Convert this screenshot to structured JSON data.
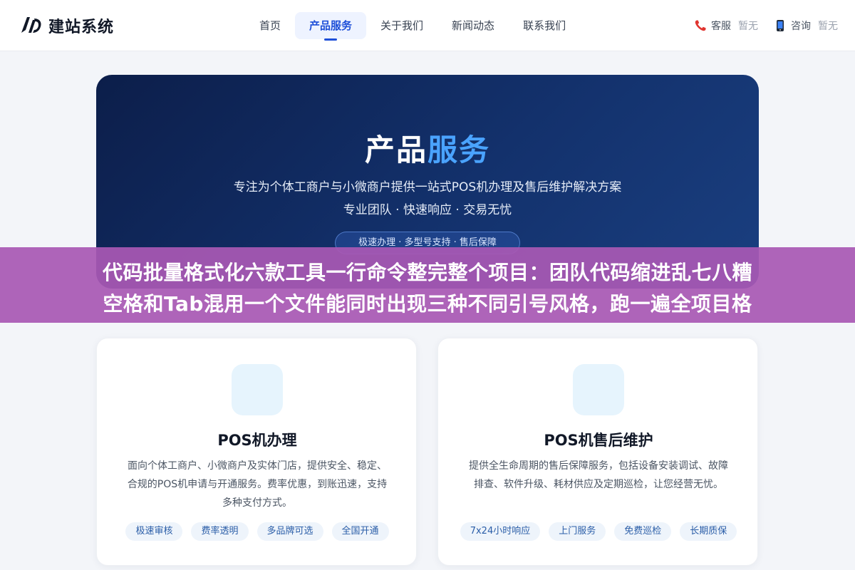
{
  "header": {
    "logo_text": "建站系统",
    "nav": [
      {
        "label": "首页"
      },
      {
        "label": "产品服务"
      },
      {
        "label": "关于我们"
      },
      {
        "label": "新闻动态"
      },
      {
        "label": "联系我们"
      }
    ],
    "active_nav": "产品服务",
    "contacts": [
      {
        "icon": "phone-icon",
        "label": "客服",
        "value": "暂无"
      },
      {
        "icon": "mobile-icon",
        "label": "咨询",
        "value": "暂无"
      }
    ]
  },
  "hero": {
    "title_main": "产品",
    "title_accent": "服务",
    "subtitle_1": "专注为个体工商户与小微商户提供一站式POS机办理及售后维护解决方案",
    "subtitle_2": "专业团队 · 快速响应 · 交易无忧",
    "pill": "极速办理 · 多型号支持 · 售后保障"
  },
  "banner": {
    "line_1": "代码批量格式化六款工具一行命令整完整个项目：团队代码缩进乱七八糟",
    "line_2": "空格和Tab混用一个文件能同时出现三种不同引号风格，跑一遍全项目格"
  },
  "cards": [
    {
      "title": "POS机办理",
      "desc": "面向个体工商户、小微商户及实体门店，提供安全、稳定、合规的POS机申请与开通服务。费率优惠，到账迅速，支持多种支付方式。",
      "tags": [
        "极速审核",
        "费率透明",
        "多品牌可选",
        "全国开通"
      ]
    },
    {
      "title": "POS机售后维护",
      "desc": "提供全生命周期的售后保障服务，包括设备安装调试、故障排查、软件升级、耗材供应及定期巡检，让您经营无忧。",
      "tags": [
        "7x24小时响应",
        "上门服务",
        "免费巡检",
        "长期质保"
      ]
    }
  ],
  "colors": {
    "accent": "#1e4fd8",
    "hero_accent": "#4aa3ff",
    "banner": "#a858b4"
  }
}
